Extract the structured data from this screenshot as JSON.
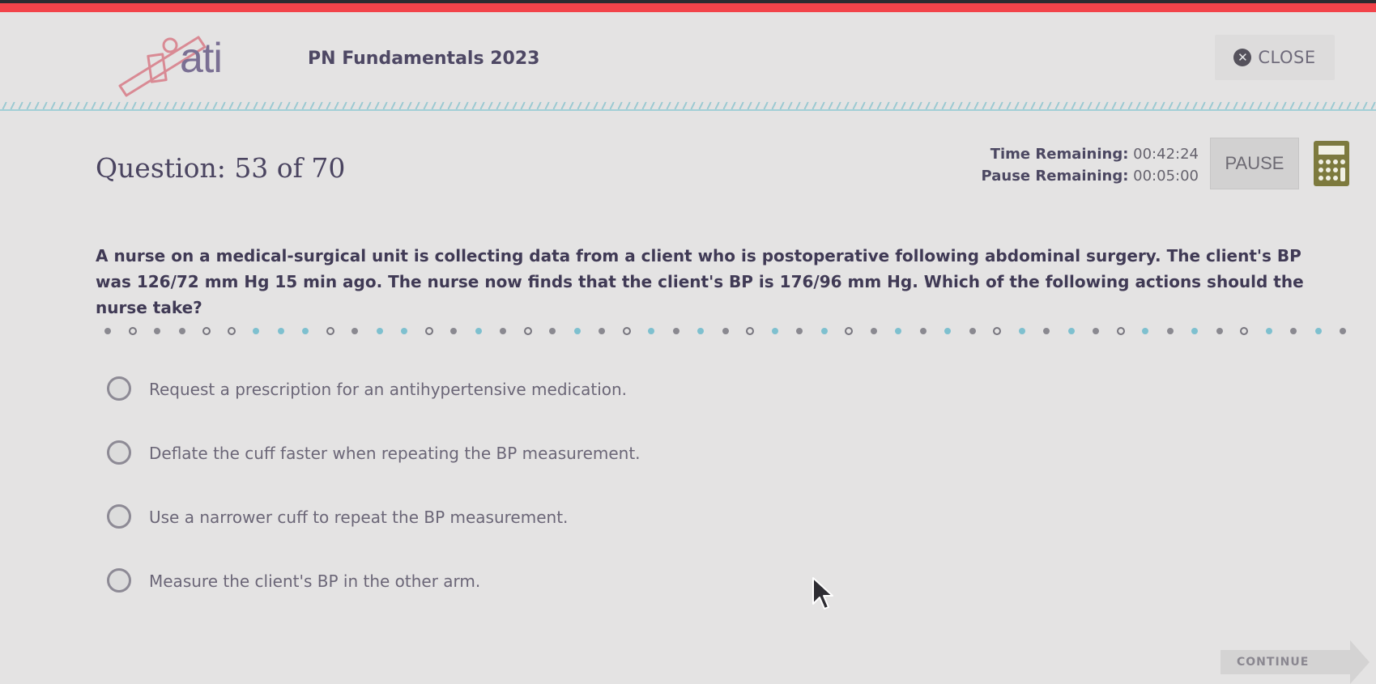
{
  "header": {
    "logo_text": "ati",
    "app_title": "PN Fundamentals 2023",
    "close_label": "CLOSE",
    "close_icon": "close-circle-icon"
  },
  "status": {
    "question_label": "Question: 53 of 70",
    "time_remaining_label": "Time Remaining:",
    "time_remaining_value": "00:42:24",
    "pause_remaining_label": "Pause Remaining:",
    "pause_remaining_value": "00:05:00",
    "pause_button": "PAUSE",
    "calculator_icon": "calculator-icon"
  },
  "question": {
    "stem": "A nurse on a medical-surgical unit is collecting data from a client who is postoperative following abdominal surgery. The client's BP was 126/72 mm Hg 15 min ago. The nurse now finds that the client's BP is 176/96 mm Hg. Which of the following actions should the nurse take?",
    "options": [
      {
        "label": "Request a prescription for an antihypertensive medication.",
        "selected": false
      },
      {
        "label": "Deflate the cuff faster when repeating the BP measurement.",
        "selected": false
      },
      {
        "label": "Use a narrower cuff to repeat the BP measurement.",
        "selected": false
      },
      {
        "label": "Measure the client's BP in the other arm.",
        "selected": false
      }
    ]
  },
  "navigation": {
    "continue_label": "CONTINUE"
  },
  "colors": {
    "top_bar": "#f2434a",
    "accent_teal": "#7ec0cf",
    "logo_pink": "#d98a94",
    "logo_purple": "#7a6f93",
    "calculator": "#7d7a3e"
  }
}
